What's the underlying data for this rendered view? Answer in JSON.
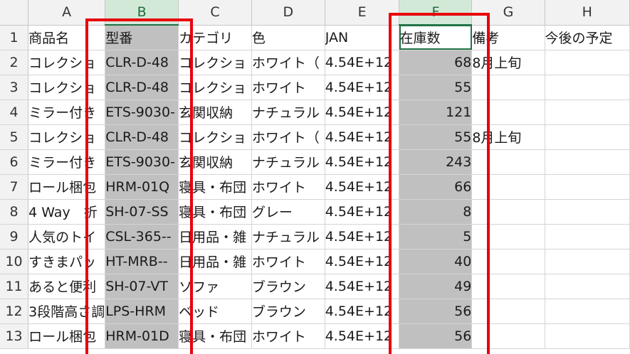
{
  "columns": [
    "A",
    "B",
    "C",
    "D",
    "E",
    "F",
    "G",
    "H"
  ],
  "rows": [
    {
      "n": "1",
      "cells": [
        "商品名",
        "型番",
        "カテゴリ",
        "色",
        "JAN",
        "在庫数",
        "備考",
        "今後の予定"
      ]
    },
    {
      "n": "2",
      "cells": [
        "コレクショ",
        "CLR-D-48",
        "コレクショ",
        "ホワイト（",
        "4.54E+12",
        "68",
        "8月上旬",
        ""
      ]
    },
    {
      "n": "3",
      "cells": [
        "コレクショ",
        "CLR-D-48",
        "コレクショ",
        "ホワイト",
        "4.54E+12",
        "55",
        "",
        ""
      ]
    },
    {
      "n": "4",
      "cells": [
        "ミラー付き",
        "ETS-9030-",
        "玄関収納",
        "ナチュラル",
        "4.54E+12",
        "121",
        "",
        ""
      ]
    },
    {
      "n": "5",
      "cells": [
        "コレクショ",
        "CLR-D-48",
        "コレクショ",
        "ホワイト（",
        "4.54E+12",
        "55",
        "8月上旬",
        ""
      ]
    },
    {
      "n": "6",
      "cells": [
        "ミラー付き",
        "ETS-9030-",
        "玄関収納",
        "ナチュラル",
        "4.54E+12",
        "243",
        "",
        ""
      ]
    },
    {
      "n": "7",
      "cells": [
        "ロール梱包",
        "HRM-01Q",
        "寝具・布団",
        "ホワイト",
        "4.54E+12",
        "66",
        "",
        ""
      ]
    },
    {
      "n": "8",
      "cells": [
        "4 Way　折",
        "SH-07-SS",
        "寝具・布団",
        "グレー",
        "4.54E+12",
        "8",
        "",
        ""
      ]
    },
    {
      "n": "9",
      "cells": [
        "人気のトイ",
        "CSL-365--",
        "日用品・雑",
        "ナチュラル",
        "4.54E+12",
        "5",
        "",
        ""
      ]
    },
    {
      "n": "10",
      "cells": [
        "すきまパッ",
        "HT-MRB--",
        "日用品・雑",
        "ホワイト",
        "4.54E+12",
        "40",
        "",
        ""
      ]
    },
    {
      "n": "11",
      "cells": [
        "あると便利",
        "SH-07-VT",
        "ソファ",
        "ブラウン",
        "4.54E+12",
        "49",
        "",
        ""
      ]
    },
    {
      "n": "12",
      "cells": [
        "3段階高さ調",
        "LPS-HRM",
        "ベッド",
        "ブラウン",
        "4.54E+12",
        "56",
        "",
        ""
      ]
    },
    {
      "n": "13",
      "cells": [
        "ロール梱包",
        "HRM-01D",
        "寝具・布団",
        "ホワイト",
        "4.54E+12",
        "56",
        "",
        ""
      ]
    }
  ],
  "selected_columns": [
    "B",
    "F"
  ],
  "active_cell": "F1",
  "highlight_color": "#e8000b"
}
